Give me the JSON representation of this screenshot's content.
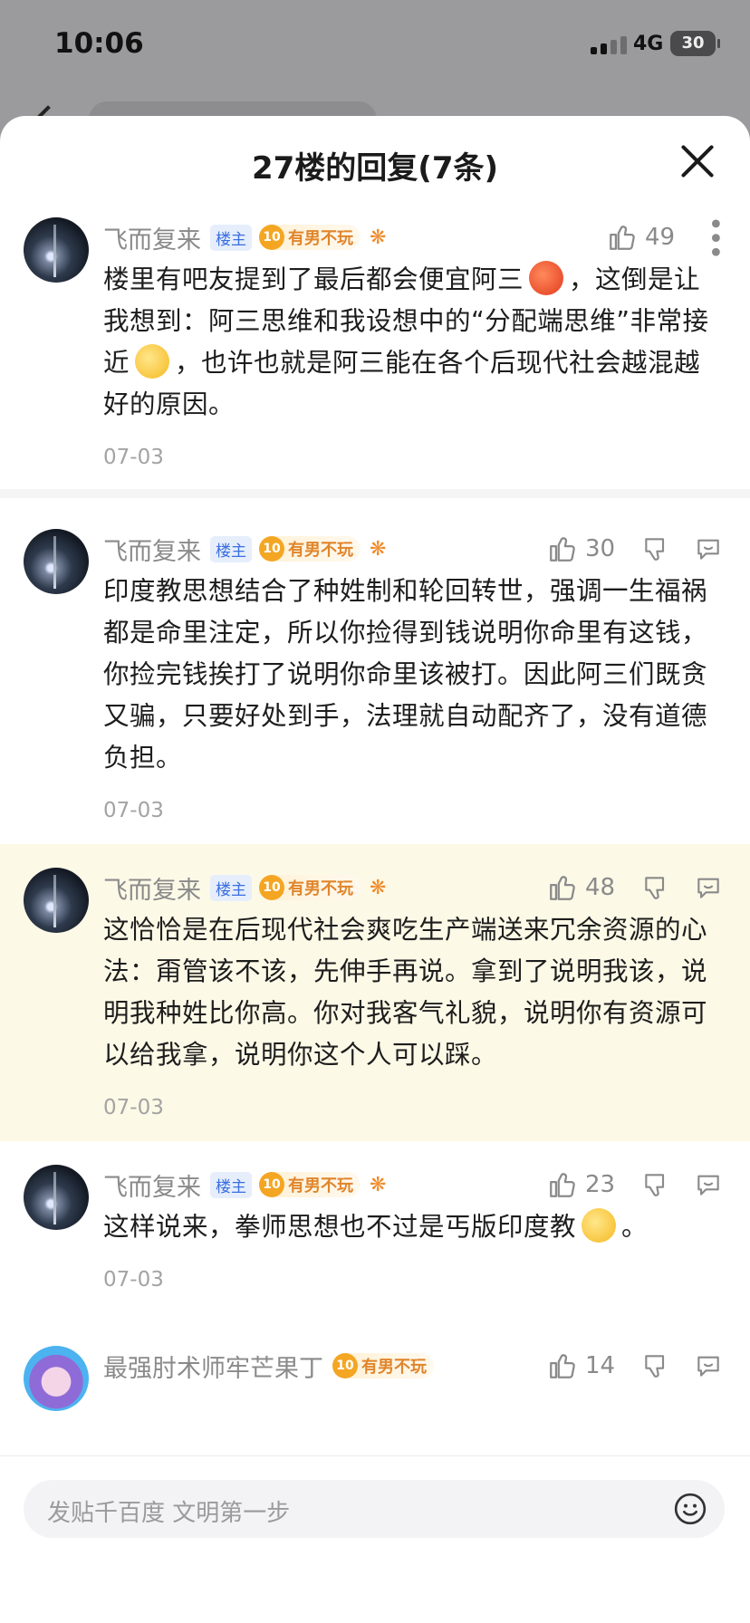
{
  "status_bar": {
    "time": "10:06",
    "network": "4G",
    "battery": "30"
  },
  "sheet": {
    "title": "27楼的回复(7条)"
  },
  "replies": [
    {
      "user": "飞而复来",
      "op_tag": "楼主",
      "level": "10",
      "level_name": "有男不玩",
      "likes": "49",
      "content_before": "楼里有吧友提到了最后都会便宜阿三",
      "content_mid": "，这倒是让我想到：阿三思维和我设想中的“分配端思维”非常接近",
      "content_after": "，也许也就是阿三能在各个后现代社会越混越好的原因。",
      "date": "07-03"
    },
    {
      "user": "飞而复来",
      "op_tag": "楼主",
      "level": "10",
      "level_name": "有男不玩",
      "likes": "30",
      "content": "印度教思想结合了种姓制和轮回转世，强调一生福祸都是命里注定，所以你捡得到钱说明你命里有这钱，你捡完钱挨打了说明你命里该被打。因此阿三们既贪又骗，只要好处到手，法理就自动配齐了，没有道德负担。",
      "date": "07-03"
    },
    {
      "user": "飞而复来",
      "op_tag": "楼主",
      "level": "10",
      "level_name": "有男不玩",
      "likes": "48",
      "content": "这恰恰是在后现代社会爽吃生产端送来冗余资源的心法：甭管该不该，先伸手再说。拿到了说明我该，说明我种姓比你高。你对我客气礼貌，说明你有资源可以给我拿，说明你这个人可以踩。",
      "date": "07-03"
    },
    {
      "user": "飞而复来",
      "op_tag": "楼主",
      "level": "10",
      "level_name": "有男不玩",
      "likes": "23",
      "content_before": "这样说来，拳师思想也不过是丐版印度教",
      "content_after": "。",
      "date": "07-03"
    },
    {
      "user": "最强肘术师牢芒果丁",
      "level": "10",
      "level_name": "有男不玩",
      "likes": "14"
    }
  ],
  "input": {
    "placeholder": "发贴千百度 文明第一步"
  },
  "icons": {
    "like": "thumbs-up-icon",
    "dislike": "thumbs-down-icon",
    "reply": "chat-bubble-icon",
    "more": "more-vertical-icon",
    "emoji": "smiley-icon",
    "close": "close-icon"
  }
}
